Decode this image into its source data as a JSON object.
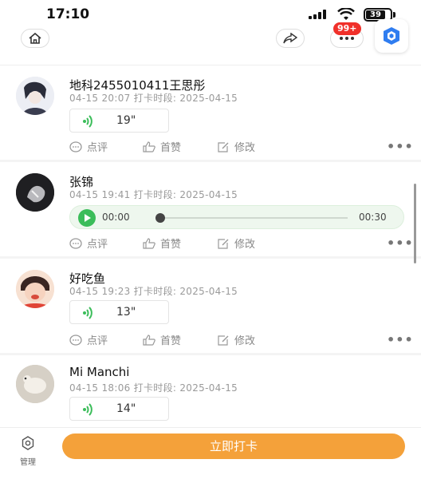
{
  "status_bar": {
    "time": "17:10",
    "battery": "39"
  },
  "nav": {
    "badge": "99+"
  },
  "posts": [
    {
      "name": "地科2455010411王思彤",
      "meta": "04-15 20:07 打卡时段: 2025-04-15",
      "voice_duration": "19\""
    },
    {
      "name": "张锦",
      "meta": "04-15 19:41 打卡时段: 2025-04-15",
      "player_current": "00:00",
      "player_total": "00:30"
    },
    {
      "name": "好吃鱼",
      "meta": "04-15 19:23 打卡时段: 2025-04-15",
      "voice_duration": "13\""
    },
    {
      "name": "Mi Manchi",
      "meta": "04-15 18:06 打卡时段: 2025-04-15",
      "voice_duration": "14\""
    }
  ],
  "actions": {
    "comment": "点评",
    "like": "首赞",
    "edit": "修改",
    "more": "•••"
  },
  "bottom": {
    "manage_label": "管理",
    "checkin_label": "立即打卡"
  },
  "colors": {
    "accent_orange": "#f4a13a",
    "voice_green": "#3bbd5a",
    "badge_red": "#f0302a"
  }
}
